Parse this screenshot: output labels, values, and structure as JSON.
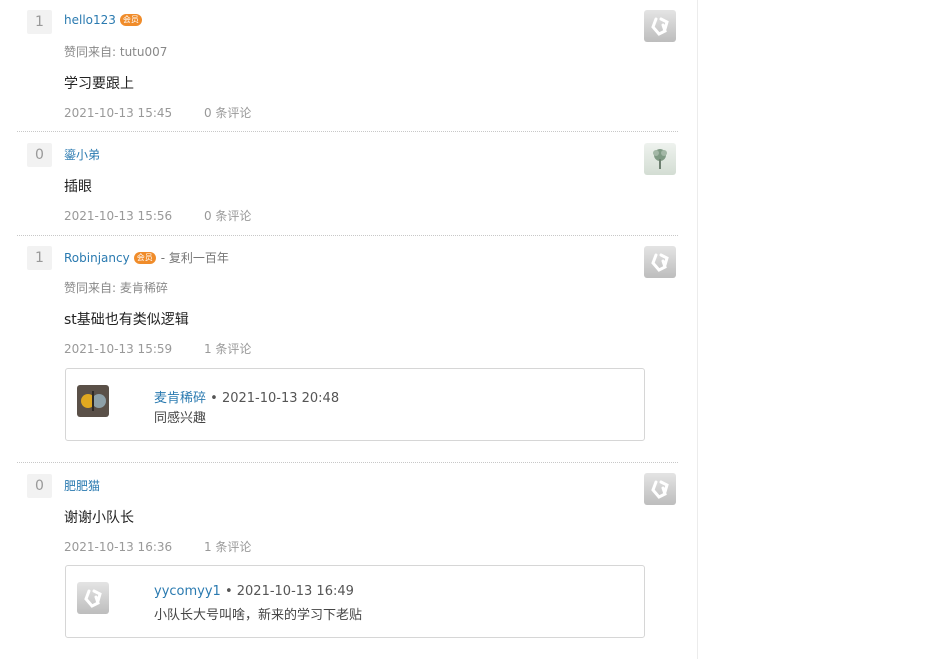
{
  "answers": [
    {
      "votes": "1",
      "author": "hello123",
      "badge": "会员",
      "agreed_by_label": "赞同来自:",
      "agreed_by": "tutu007",
      "content": "学习要跟上",
      "time": "2021-10-13 15:45",
      "comments": "0 条评论",
      "avatar_icon": "default-avatar-icon"
    },
    {
      "votes": "0",
      "author": "鎏小弟",
      "content": "插眼",
      "time": "2021-10-13 15:56",
      "comments": "0 条评论",
      "avatar_icon": "plant-avatar-icon"
    },
    {
      "votes": "1",
      "author": "Robinjancy",
      "badge": "会员",
      "author_title": "- 复利一百年",
      "agreed_by_label": "赞同来自:",
      "agreed_by": "麦肯稀碎",
      "content": "st基础也有类似逻辑",
      "time": "2021-10-13 15:59",
      "comments": "1 条评论",
      "avatar_icon": "default-avatar-icon",
      "comment": {
        "author": "麦肯稀碎",
        "time": "• 2021-10-13 20:48",
        "text": "同感兴趣",
        "avatar_icon": "photo-avatar-icon"
      }
    },
    {
      "votes": "0",
      "author": "肥肥猫",
      "content": "谢谢小队长",
      "time": "2021-10-13 16:36",
      "comments": "1 条评论",
      "avatar_icon": "default-avatar-icon",
      "comment": {
        "author": "yycomyy1",
        "time": "• 2021-10-13 16:49",
        "text": "小队长大号叫啥，新来的学习下老贴",
        "avatar_icon": "default-avatar-icon"
      }
    }
  ],
  "colors": {
    "link": "#2a7ab0",
    "badge": "#f08c2a",
    "muted": "#999999"
  }
}
